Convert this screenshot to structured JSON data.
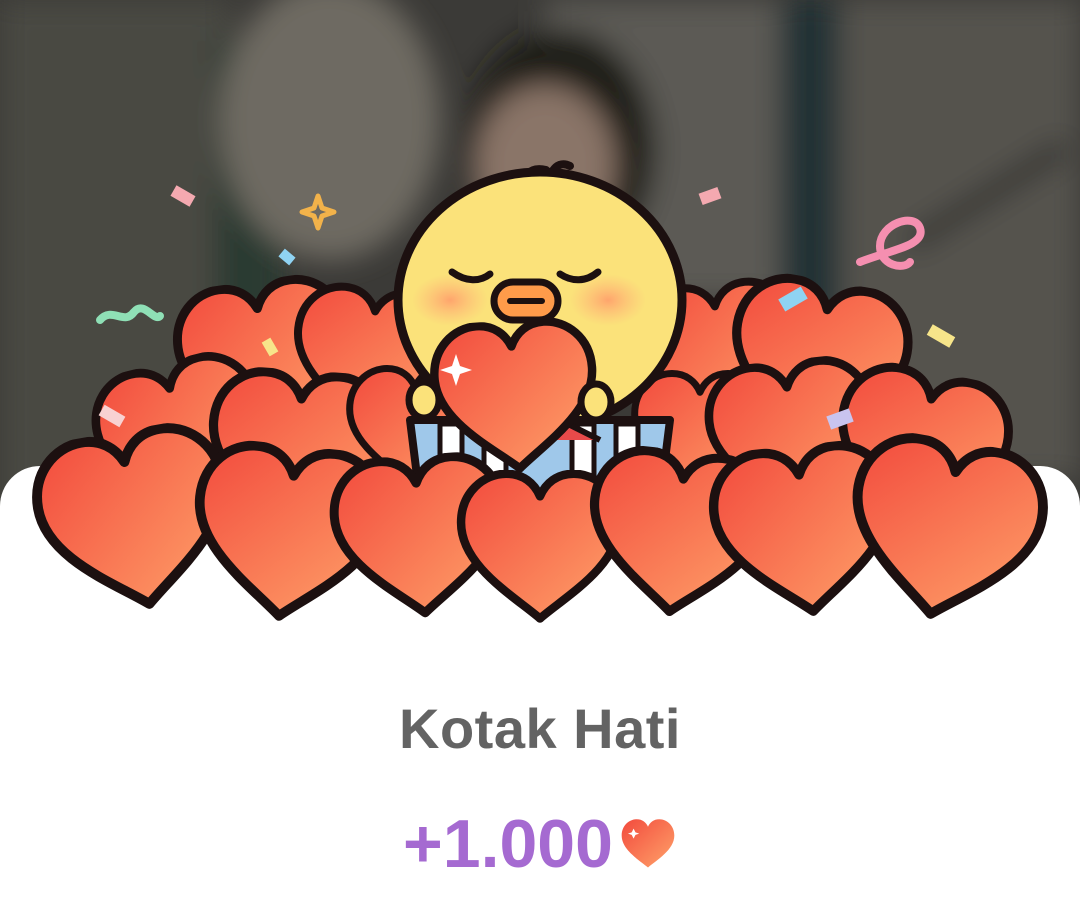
{
  "reward_card": {
    "title": "Kotak Hati",
    "amount": "+1.000",
    "currency_icon": "heart-icon",
    "accent_color": "#a56ad1",
    "title_color": "#636363"
  },
  "illustration": {
    "character": "yellow-chick",
    "prop": "heart-gift-box",
    "heart_color": "#f4573f",
    "confetti": true
  }
}
